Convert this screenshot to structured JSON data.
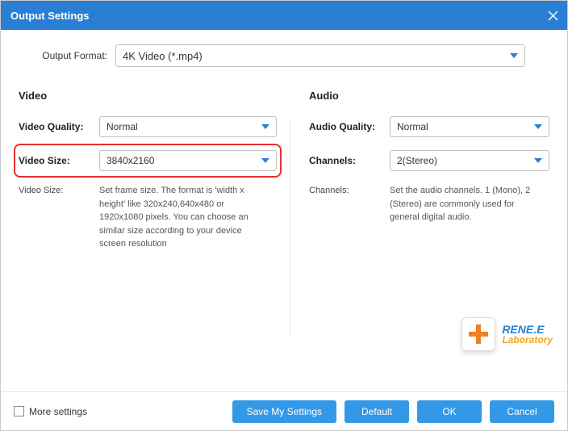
{
  "title": "Output Settings",
  "format": {
    "label": "Output Format:",
    "value": "4K Video (*.mp4)"
  },
  "video": {
    "heading": "Video",
    "quality_label": "Video Quality:",
    "quality_value": "Normal",
    "size_label": "Video Size:",
    "size_value": "3840x2160",
    "desc_label": "Video Size:",
    "desc_text": "Set frame size. The format is 'width x height' like 320x240,640x480 or 1920x1080 pixels. You can choose an similar size according to your device screen resolution"
  },
  "audio": {
    "heading": "Audio",
    "quality_label": "Audio Quality:",
    "quality_value": "Normal",
    "channels_label": "Channels:",
    "channels_value": "2(Stereo)",
    "desc_label": "Channels:",
    "desc_text": "Set the audio channels. 1 (Mono), 2 (Stereo) are commonly used for general digital audio."
  },
  "logo": {
    "brand": "RENE.E",
    "sub": "Laboratory"
  },
  "footer": {
    "more": "More settings",
    "save": "Save My Settings",
    "default": "Default",
    "ok": "OK",
    "cancel": "Cancel"
  }
}
